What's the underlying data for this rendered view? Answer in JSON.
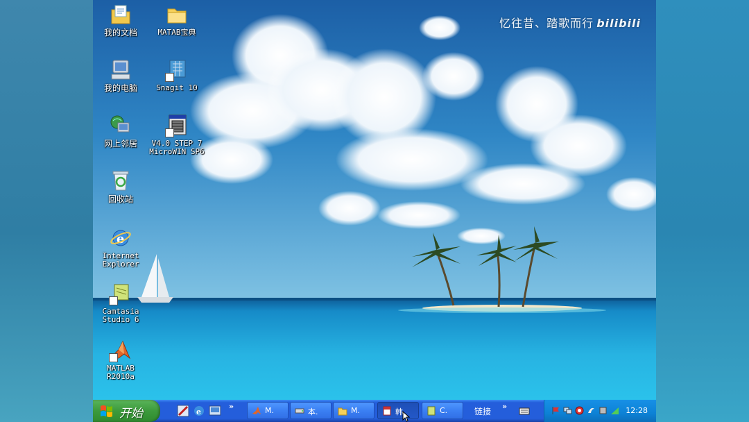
{
  "watermark": {
    "text": "忆往昔、踏歌而行",
    "logo": "bilibili"
  },
  "desktop_icons": [
    {
      "label": "我的文档",
      "icon": "my-documents-icon"
    },
    {
      "label": "MATAB宝典",
      "icon": "folder-icon"
    },
    {
      "label": "我的电脑",
      "icon": "my-computer-icon"
    },
    {
      "label": "Snagit 10",
      "icon": "snagit-icon"
    },
    {
      "label": "网上邻居",
      "icon": "network-places-icon"
    },
    {
      "label": "V4.0 STEP 7\nMicroWIN SP6",
      "icon": "step7-microwin-icon"
    },
    {
      "label": "回收站",
      "icon": "recycle-bin-icon"
    },
    {
      "label": "Internet\nExplorer",
      "icon": "internet-explorer-icon"
    },
    {
      "label": "Camtasia\nStudio 6",
      "icon": "camtasia-icon"
    },
    {
      "label": "MATLAB\nR2010a",
      "icon": "matlab-icon"
    }
  ],
  "taskbar": {
    "start_label": "开始",
    "chevron": "»",
    "buttons": [
      {
        "label": "M.",
        "icon": "matlab-icon"
      },
      {
        "label": "本.",
        "icon": "drive-icon"
      },
      {
        "label": "M.",
        "icon": "folder-icon"
      },
      {
        "label": "韩",
        "icon": "document-icon",
        "active": true
      },
      {
        "label": "C.",
        "icon": "camtasia-icon"
      }
    ],
    "links_label": "链接",
    "clock": "12:28"
  },
  "colors": {
    "taskbar": "#245edb",
    "start": "#3c9a3c",
    "tray": "#0d82d6",
    "sea": "#1aa7d8",
    "sky": "#1f6fb3"
  }
}
